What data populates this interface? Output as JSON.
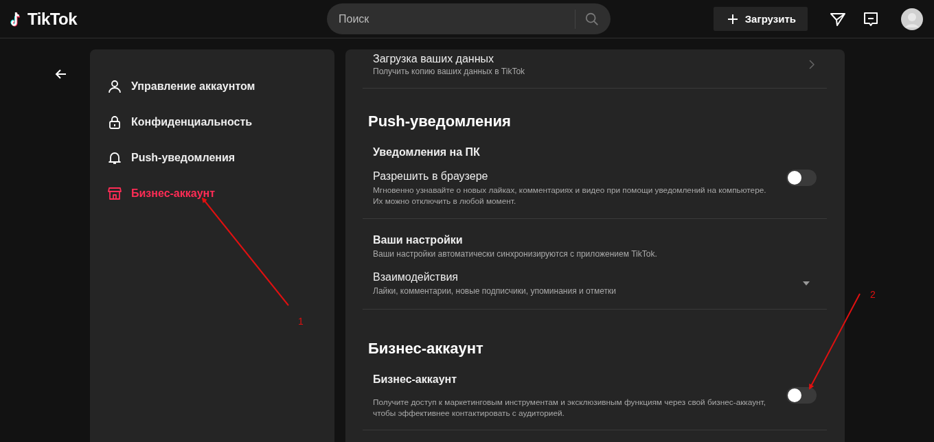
{
  "header": {
    "logo": "TikTok",
    "search": {
      "placeholder": "Поиск"
    },
    "upload_button": "Загрузить"
  },
  "sidebar": {
    "items": [
      {
        "label": "Управление аккаунтом",
        "selected": false
      },
      {
        "label": "Конфиденциальность",
        "selected": false
      },
      {
        "label": "Push-уведомления",
        "selected": false
      },
      {
        "label": "Бизнес-аккаунт",
        "selected": true
      }
    ]
  },
  "content": {
    "items": [
      {
        "kind": "link",
        "title": "Загрузка ваших данных",
        "subtitle": "Получить копию ваших данных в TikTok"
      },
      {
        "kind": "divider"
      },
      {
        "kind": "heading",
        "text": "Push-уведомления"
      },
      {
        "kind": "subheading",
        "text": "Уведомления на ПК"
      },
      {
        "kind": "toggle",
        "title": "Разрешить в браузере",
        "description": "Мгновенно узнавайте о новых лайках, комментариях и видео при помощи уведомлений на компьютере. Их можно отключить в любой момент.",
        "on": false
      },
      {
        "kind": "divider"
      },
      {
        "kind": "group",
        "title": "Ваши настройки",
        "subtitle": "Ваши настройки автоматически синхронизируются с приложением TikTok."
      },
      {
        "kind": "dropdown",
        "title": "Взаимодействия",
        "subtitle": "Лайки, комментарии, новые подписчики, упоминания и отметки"
      },
      {
        "kind": "divider"
      },
      {
        "kind": "heading",
        "text": "Бизнес-аккаунт"
      },
      {
        "kind": "subheading",
        "text": "Бизнес-аккаунт"
      },
      {
        "kind": "toggle",
        "description": "Получите доступ к маркетинговым инструментам и эксклюзивным функциям через свой бизнес-аккаунт, чтобы эффективнее контактировать с аудиторией.",
        "on": false
      },
      {
        "kind": "divider"
      }
    ]
  },
  "annotations": [
    {
      "label": "1"
    },
    {
      "label": "2"
    }
  ]
}
